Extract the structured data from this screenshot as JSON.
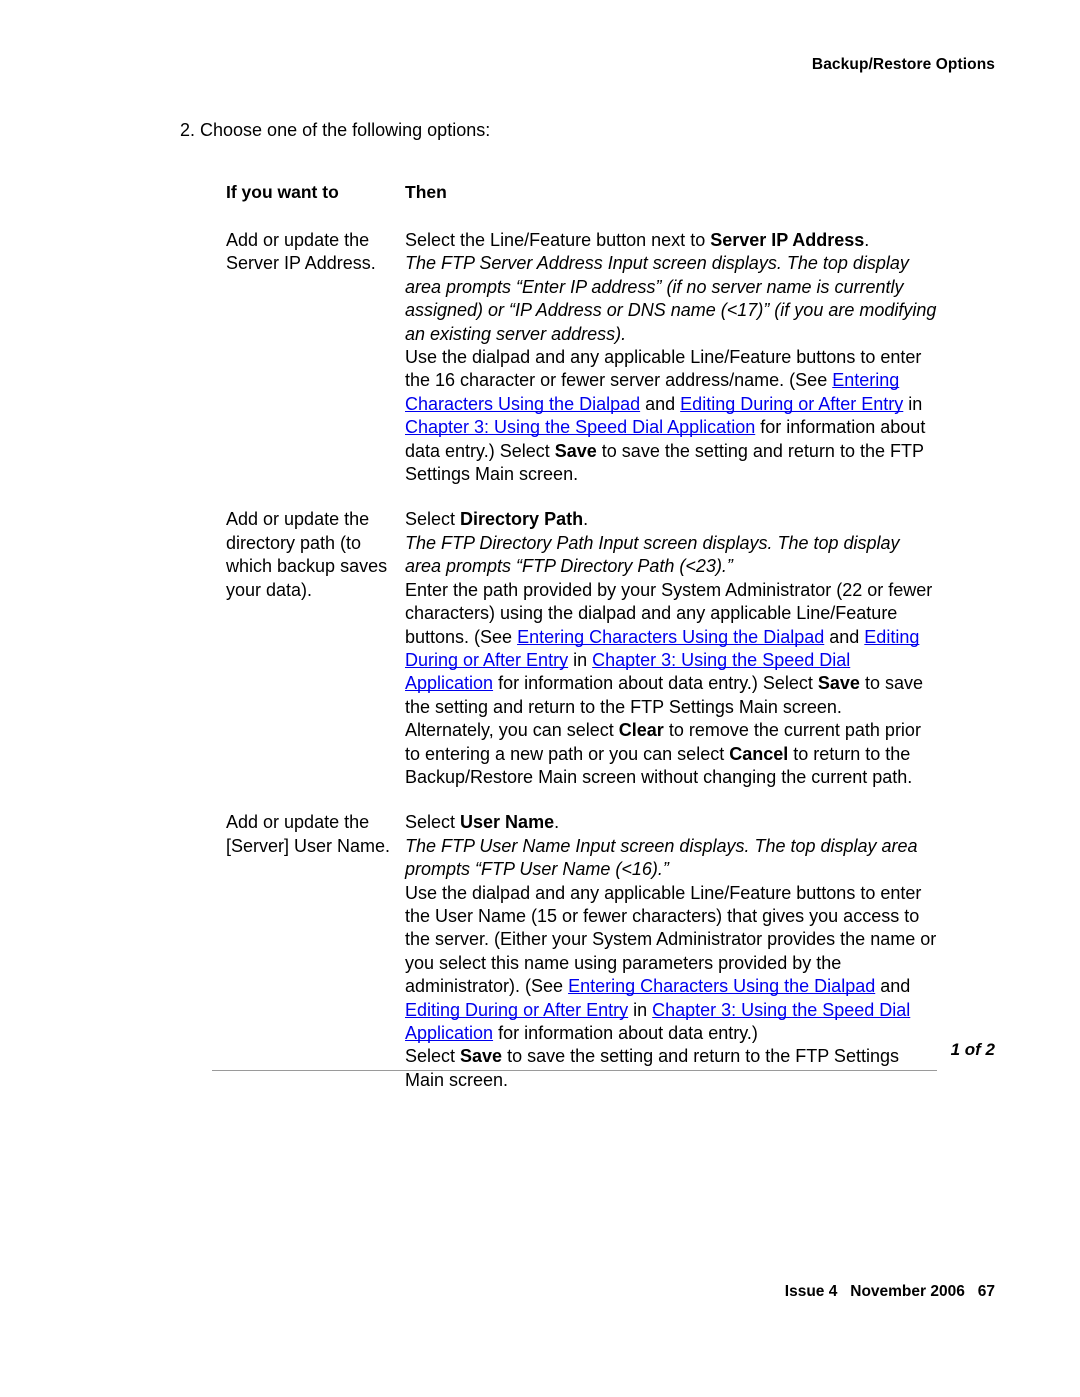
{
  "header": {
    "running_head": "Backup/Restore Options"
  },
  "step": {
    "text": "2. Choose one of the following options:"
  },
  "table": {
    "columns": [
      {
        "label": "If you want to"
      },
      {
        "label": "Then"
      }
    ],
    "rows": [
      {
        "if_you_want_to": "Add or update the Server IP Address.",
        "then": {
          "p1_pre": "Select the Line/Feature button next to ",
          "p1_bold": "Server IP Address",
          "p1_post": ".",
          "p2_italic": "The FTP Server Address Input screen displays. The top display area prompts “Enter IP address” (if no server name is currently assigned) or “IP Address or DNS name (<17)” (if you are modifying an existing server address).",
          "p3_a": "Use the dialpad and any applicable Line/Feature buttons to enter the 16 character or fewer server address/name. (See ",
          "p3_link1": "Entering Characters Using the Dialpad",
          "p3_b": " and ",
          "p3_link2": "Editing During or After Entry",
          "p3_c": " in ",
          "p3_link3": "Chapter 3: Using the Speed Dial Application",
          "p3_d": " for information about data entry.) Select ",
          "p3_bold": "Save",
          "p3_e": " to save the setting and return to the FTP Settings Main screen."
        }
      },
      {
        "if_you_want_to": "Add or update the directory path (to which backup saves your data).",
        "then": {
          "p1_pre": "Select ",
          "p1_bold": "Directory Path",
          "p1_post": ".",
          "p2_italic": "The FTP Directory Path Input screen displays. The top display area prompts “FTP Directory Path (<23).”",
          "p3_a": "Enter the path provided by your System Administrator (22 or fewer characters) using the dialpad and any applicable Line/Feature buttons. (See ",
          "p3_link1": "Entering Characters Using the Dialpad",
          "p3_b": " and ",
          "p3_link2": "Editing During or After Entry",
          "p3_c": " in ",
          "p3_link3": "Chapter 3: Using the Speed Dial Application",
          "p3_d": " for information about data entry.) Select ",
          "p3_bold": "Save",
          "p3_e": " to save the setting and return to the FTP Settings Main screen.",
          "p4_a": "Alternately, you can select ",
          "p4_bold1": "Clear",
          "p4_b": " to remove the current path prior to entering a new path or you can select ",
          "p4_bold2": "Cancel",
          "p4_c": " to return to the Backup/Restore Main screen without changing the current path."
        }
      },
      {
        "if_you_want_to": "Add or update the [Server] User Name.",
        "then": {
          "p1_pre": "Select ",
          "p1_bold": "User Name",
          "p1_post": ".",
          "p2_italic": "The FTP User Name Input screen displays. The top display area prompts “FTP User Name (<16).”",
          "p3_a": "Use the dialpad and any applicable Line/Feature buttons to enter the User Name (15 or fewer characters) that gives you access to the server. (Either your System Administrator provides the name or you select this name using parameters provided by the administrator). (See ",
          "p3_link1": "Entering Characters Using the Dialpad",
          "p3_b": " and ",
          "p3_link2": "Editing During or After Entry",
          "p3_c": " in ",
          "p3_link3": "Chapter 3: Using the Speed Dial Application",
          "p3_d": " for information about data entry.)",
          "p4_a": "Select ",
          "p4_bold": "Save",
          "p4_b": " to save the setting and return to the FTP Settings Main screen."
        }
      }
    ],
    "continuation": "1 of 2"
  },
  "footer": {
    "text": "Issue 4   November 2006   67"
  },
  "colors": {
    "link": "#0000ee",
    "rule": "#9a9a9a",
    "text": "#000000"
  }
}
